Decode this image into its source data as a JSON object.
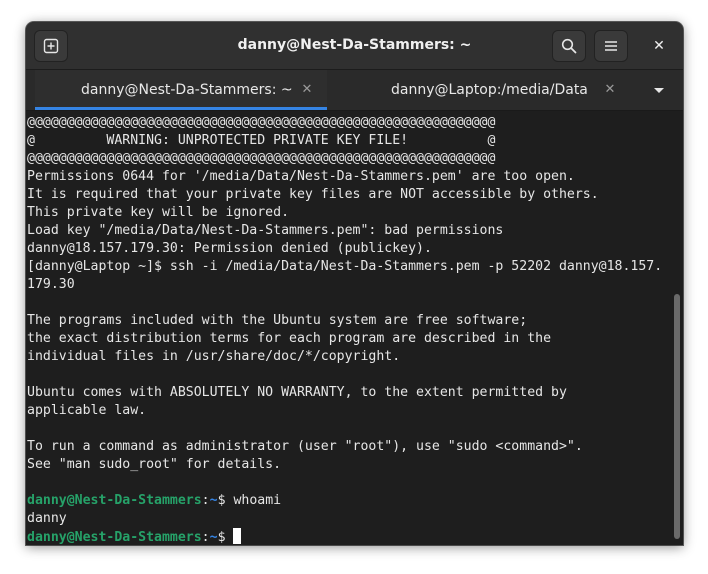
{
  "window": {
    "title": "danny@Nest-Da-Stammers: ~"
  },
  "headerbar": {
    "new_tab_icon": "new-tab-icon",
    "search_icon": "search-icon",
    "menu_icon": "hamburger-menu-icon",
    "close_icon": "close-icon",
    "close_glyph": "✕"
  },
  "tabs": [
    {
      "label": "danny@Nest-Da-Stammers: ~",
      "close": "✕",
      "active": true
    },
    {
      "label": "danny@Laptop:/media/Data",
      "close": "✕",
      "active": false
    }
  ],
  "tab_menu_icon": "chevron-down-icon",
  "terminal": {
    "lines": [
      "@@@@@@@@@@@@@@@@@@@@@@@@@@@@@@@@@@@@@@@@@@@@@@@@@@@@@@@@@@@",
      "@         WARNING: UNPROTECTED PRIVATE KEY FILE!          @",
      "@@@@@@@@@@@@@@@@@@@@@@@@@@@@@@@@@@@@@@@@@@@@@@@@@@@@@@@@@@@",
      "Permissions 0644 for '/media/Data/Nest-Da-Stammers.pem' are too open.",
      "It is required that your private key files are NOT accessible by others.",
      "This private key will be ignored.",
      "Load key \"/media/Data/Nest-Da-Stammers.pem\": bad permissions",
      "danny@18.157.179.30: Permission denied (publickey).",
      "[danny@Laptop ~]$ ssh -i /media/Data/Nest-Da-Stammers.pem -p 52202 danny@18.157.",
      "179.30",
      "",
      "The programs included with the Ubuntu system are free software;",
      "the exact distribution terms for each program are described in the",
      "individual files in /usr/share/doc/*/copyright.",
      "",
      "Ubuntu comes with ABSOLUTELY NO WARRANTY, to the extent permitted by",
      "applicable law.",
      "",
      "To run a command as administrator (user \"root\"), use \"sudo <command>\".",
      "See \"man sudo_root\" for details.",
      ""
    ],
    "prompt1": {
      "user": "danny@Nest-Da-Stammers",
      "sep": ":",
      "path": "~",
      "symbol": "$ ",
      "command": "whoami"
    },
    "output": "danny",
    "prompt2": {
      "user": "danny@Nest-Da-Stammers",
      "sep": ":",
      "path": "~",
      "symbol": "$ ",
      "command": ""
    }
  },
  "colors": {
    "prompt_user": "#26a269",
    "prompt_path": "#3584e4",
    "accent": "#3584e4",
    "background": "#1e1e1e"
  }
}
